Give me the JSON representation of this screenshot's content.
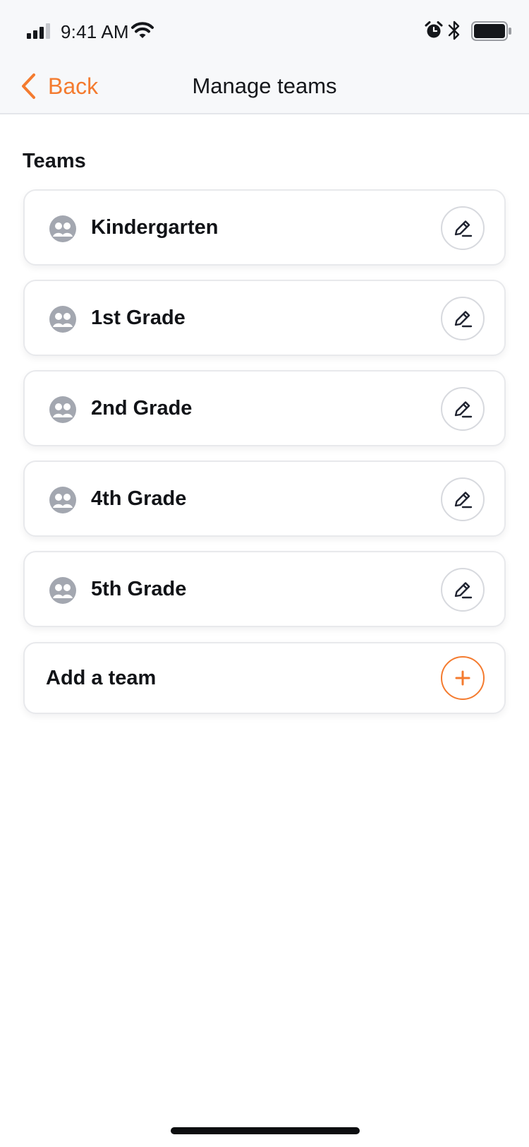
{
  "status_bar": {
    "time": "9:41 AM",
    "icons": [
      "signal-icon",
      "wifi-icon",
      "alarm-icon",
      "bluetooth-icon",
      "battery-icon"
    ]
  },
  "nav": {
    "back_label": "Back",
    "title": "Manage teams"
  },
  "teams_section": {
    "title": "Teams",
    "items": [
      {
        "name": "Kindergarten",
        "icon": "team-icon"
      },
      {
        "name": "1st Grade",
        "icon": "team-icon"
      },
      {
        "name": "2nd Grade",
        "icon": "team-icon"
      },
      {
        "name": "4th Grade",
        "icon": "team-icon"
      },
      {
        "name": "5th Grade",
        "icon": "team-icon"
      }
    ],
    "edit_icon": "pencil-icon"
  },
  "add_team": {
    "label": "Add a team",
    "icon": "plus-icon"
  },
  "colors": {
    "accent": "#f47b2f",
    "header_background": "#f7f8fa",
    "team_icon": "#a3a7b0",
    "text": "#111317",
    "card_border": "#e8e9ec"
  }
}
